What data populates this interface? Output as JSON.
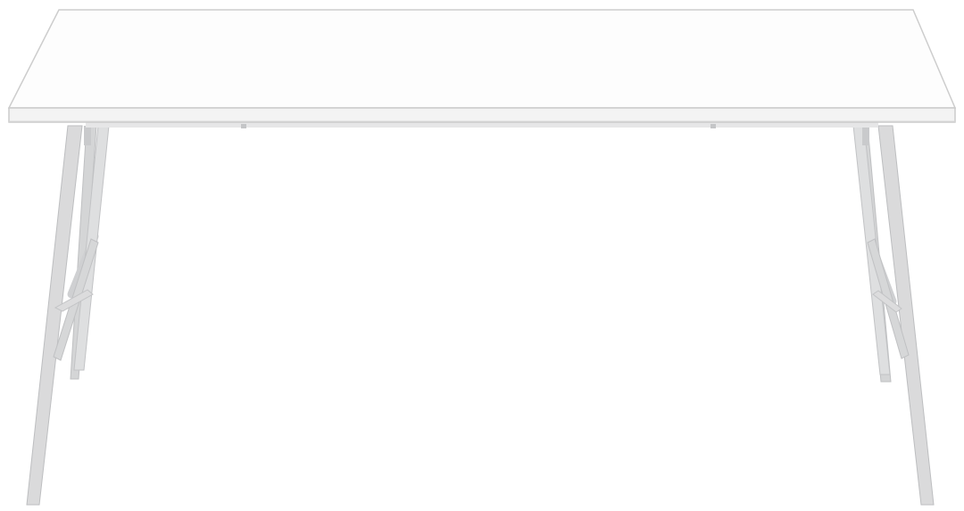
{
  "image": {
    "subject": "table",
    "background_color": "#ffffff",
    "colors": {
      "tabletop_surface": "#fdfdfd",
      "tabletop_edge": "#dcdcdc",
      "tabletop_outline": "#c9c9c9",
      "leg_frame": "#d9d9da",
      "leg_shadow": "#bfc0c2",
      "leg_highlight": "#ececed"
    }
  }
}
